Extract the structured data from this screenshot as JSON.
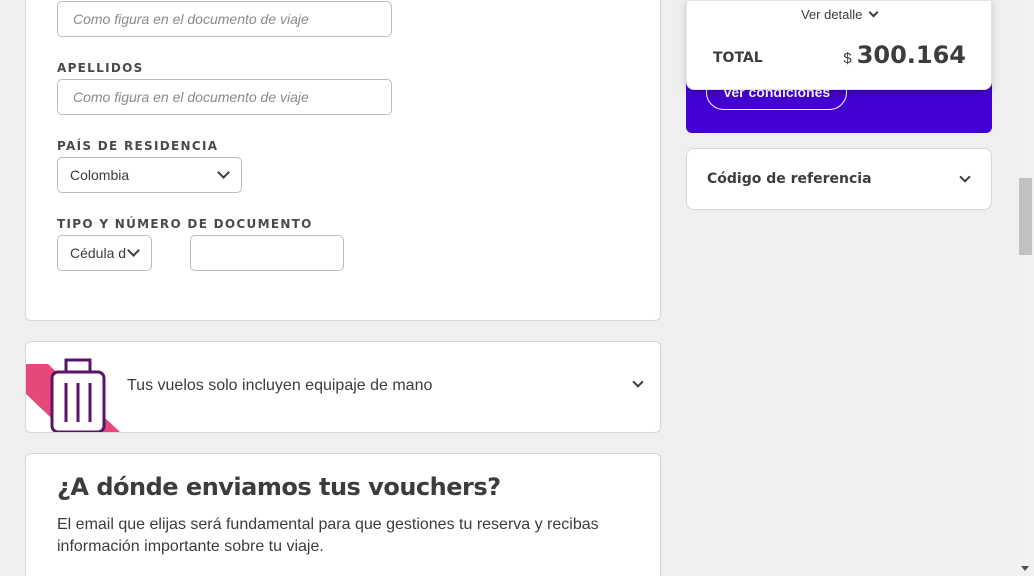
{
  "form": {
    "nombres_placeholder": "Como figura en el documento de viaje",
    "apellidos_label": "APELLIDOS",
    "apellidos_placeholder": "Como figura en el documento de viaje",
    "pais_label": "PAÍS DE RESIDENCIA",
    "pais_value": "Colombia",
    "documento_label": "TIPO Y NÚMERO DE DOCUMENTO",
    "documento_tipo_value": "Cédula de",
    "documento_numero_value": ""
  },
  "baggage": {
    "text": "Tus vuelos solo incluyen equipaje de mano",
    "accent_color": "#e4497a",
    "icon_color": "#5a1469"
  },
  "vouchers": {
    "title": "¿A dónde enviamos tus vouchers?",
    "description": "El email que elijas será fundamental para que gestiones tu reserva y recibas información importante sobre tu viaje."
  },
  "summary": {
    "ver_detalle": "Ver detalle",
    "total_label": "TOTAL",
    "currency": "$",
    "total_value": "300.164",
    "conditions_button": "Ver condiciones",
    "brand_color": "#4300d2"
  },
  "reference": {
    "label": "Código de referencia"
  }
}
